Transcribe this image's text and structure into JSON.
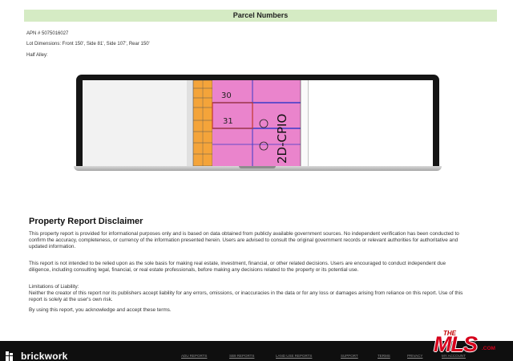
{
  "parcel": {
    "header": "Parcel Numbers",
    "apn": "APN # 5075016027",
    "lot_dimensions": "Lot Dimensions:  Front 150', Side 81', Side 107', Rear 150'",
    "half_alley": "Half Alley:"
  },
  "map": {
    "lot_numbers": [
      "30",
      "31"
    ],
    "zoning_label": "2D-CPIO",
    "colors": {
      "parcel_pink": "#ea84cc",
      "commercial_orange": "#f4a43a",
      "boundary_blue": "#3b3bc8",
      "street_red": "#c0392b"
    }
  },
  "disclaimer": {
    "title": "Property Report Disclaimer",
    "p1": "This property report is provided for informational purposes only and is based on data obtained from publicly available government sources. No independent verification has been conducted to confirm the accuracy, completeness, or currency of the information presented herein. Users are advised to consult the original government records or relevant authorities for authoritative and updated information.",
    "p2": "This report is not intended to be relied upon as the sole basis for making real estate, investment, financial, or other related decisions. Users are encouraged to conduct independent due diligence, including consulting legal, financial, or real estate professionals, before making any decisions related to the property or its potential use.",
    "p3_heading": "Limitations of Liability:",
    "p3": "Neither the creator of this report nor its publishers accept liability for any errors, omissions, or inaccuracies in the data or for any loss or damages arising from reliance on this report. Use of this report is solely at the user's own risk.",
    "p4": "By using this report, you acknowledge and accept these terms."
  },
  "footer": {
    "brand": "brickwork",
    "links": [
      "ADU REPORTS",
      "SB9 REPORTS",
      "LAND USE REPORTS",
      "SUPPORT",
      "TERMS",
      "PRIVACY",
      "MY ACCOUNT"
    ]
  },
  "watermark": {
    "the": "THE",
    "mls": "MLS",
    "com": ".COM"
  }
}
